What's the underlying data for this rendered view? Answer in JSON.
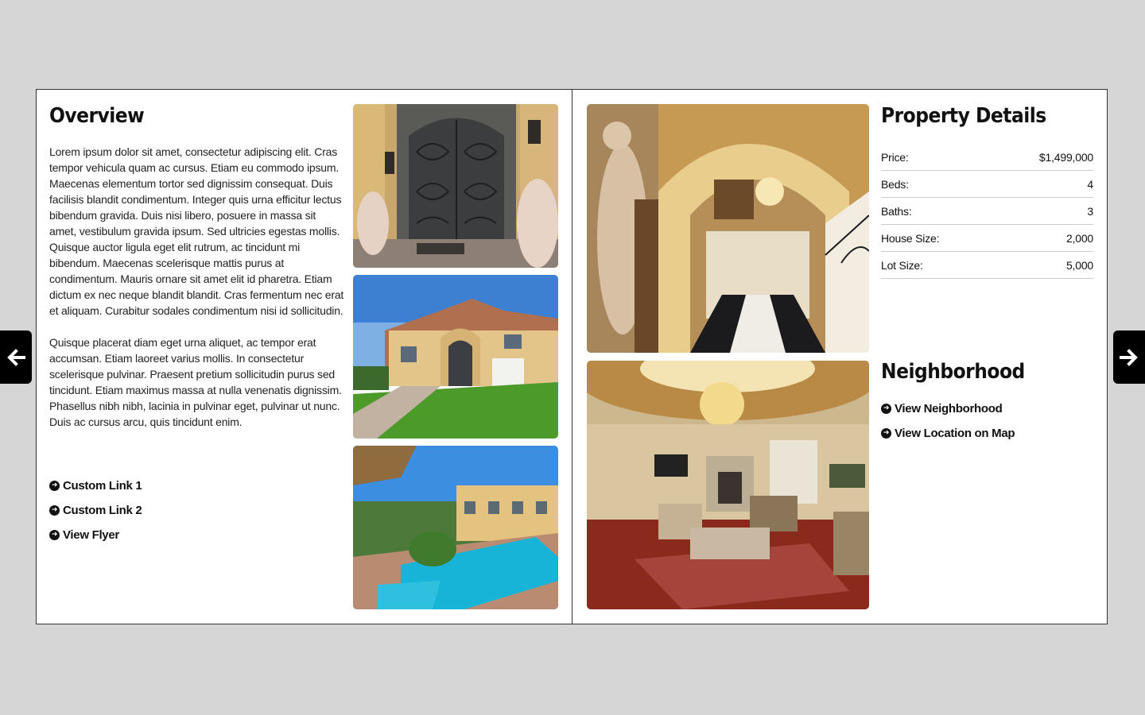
{
  "overview": {
    "title": "Overview",
    "paragraphs": [
      "Lorem ipsum dolor sit amet, consectetur adipiscing elit. Cras tempor vehicula quam ac cursus. Etiam eu commodo ipsum. Maecenas elementum tortor sed dignissim consequat. Duis facilisis blandit condimentum. Integer quis urna efficitur lectus bibendum gravida. Duis nisi libero, posuere in massa sit amet, vestibulum gravida ipsum. Sed ultricies egestas mollis. Quisque auctor ligula eget elit rutrum, ac tincidunt mi bibendum. Maecenas scelerisque mattis purus at condimentum. Mauris ornare sit amet elit id pharetra. Etiam dictum ex nec neque blandit blandit. Cras fermentum nec erat et aliquam. Curabitur sodales condimentum nisi id sollicitudin.",
      "Quisque placerat diam eget urna aliquet, ac tempor erat accumsan. Etiam laoreet varius mollis. In consectetur scelerisque pulvinar. Praesent pretium sollicitudin purus sed tincidunt. Etiam maximus massa at nulla venenatis dignissim. Phasellus nibh nibh, lacinia in pulvinar eget, pulvinar ut nunc. Duis ac cursus arcu, quis tincidunt enim."
    ],
    "links": [
      "Custom Link 1",
      "Custom Link 2",
      "View Flyer"
    ]
  },
  "property_details": {
    "title": "Property Details",
    "rows": [
      {
        "label": "Price:",
        "value": "$1,499,000"
      },
      {
        "label": "Beds:",
        "value": "4"
      },
      {
        "label": "Baths:",
        "value": "3"
      },
      {
        "label": "House Size:",
        "value": "2,000"
      },
      {
        "label": "Lot Size:",
        "value": "5,000"
      }
    ]
  },
  "neighborhood": {
    "title": "Neighborhood",
    "links": [
      "View Neighborhood",
      "View Location on Map"
    ]
  },
  "nav": {
    "prev_icon": "arrow-left-icon",
    "next_icon": "arrow-right-icon"
  },
  "colors": {
    "background": "#d6d6d6",
    "page": "#ffffff",
    "nav": "#000000"
  }
}
